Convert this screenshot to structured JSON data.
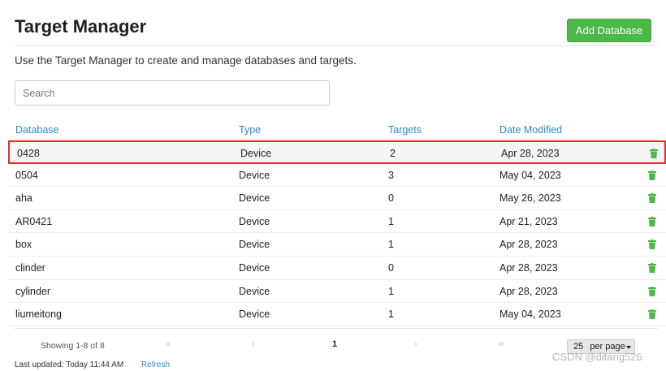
{
  "header": {
    "title": "Target Manager",
    "add_button": "Add Database"
  },
  "description": "Use the Target Manager to create and manage databases and targets.",
  "search": {
    "placeholder": "Search",
    "value": ""
  },
  "table": {
    "columns": [
      "Database",
      "Type",
      "Targets",
      "Date Modified"
    ],
    "rows": [
      {
        "database": "0428",
        "type": "Device",
        "targets": "2",
        "date": "Apr 28, 2023",
        "selected": true
      },
      {
        "database": "0504",
        "type": "Device",
        "targets": "3",
        "date": "May 04, 2023"
      },
      {
        "database": "aha",
        "type": "Device",
        "targets": "0",
        "date": "May 26, 2023"
      },
      {
        "database": "AR0421",
        "type": "Device",
        "targets": "1",
        "date": "Apr 21, 2023"
      },
      {
        "database": "box",
        "type": "Device",
        "targets": "1",
        "date": "Apr 28, 2023"
      },
      {
        "database": "clinder",
        "type": "Device",
        "targets": "0",
        "date": "Apr 28, 2023"
      },
      {
        "database": "cylinder",
        "type": "Device",
        "targets": "1",
        "date": "Apr 28, 2023"
      },
      {
        "database": "liumeitong",
        "type": "Device",
        "targets": "1",
        "date": "May 04, 2023"
      }
    ],
    "row_icon": "trash-icon"
  },
  "pagination": {
    "showing": "Showing 1-8 of 8",
    "first": "«",
    "prev": "‹",
    "current_page": "1",
    "next": "›",
    "last": "»",
    "per_page_value": "25",
    "per_page_label": "per page"
  },
  "footer": {
    "last_updated": "Last updated: Today 11:44 AM",
    "refresh": "Refresh"
  },
  "watermark": "CSDN @ditang526",
  "colors": {
    "accent_green": "#4cb848",
    "link_blue": "#2a8ccf",
    "selection_red": "#e12b2b"
  }
}
